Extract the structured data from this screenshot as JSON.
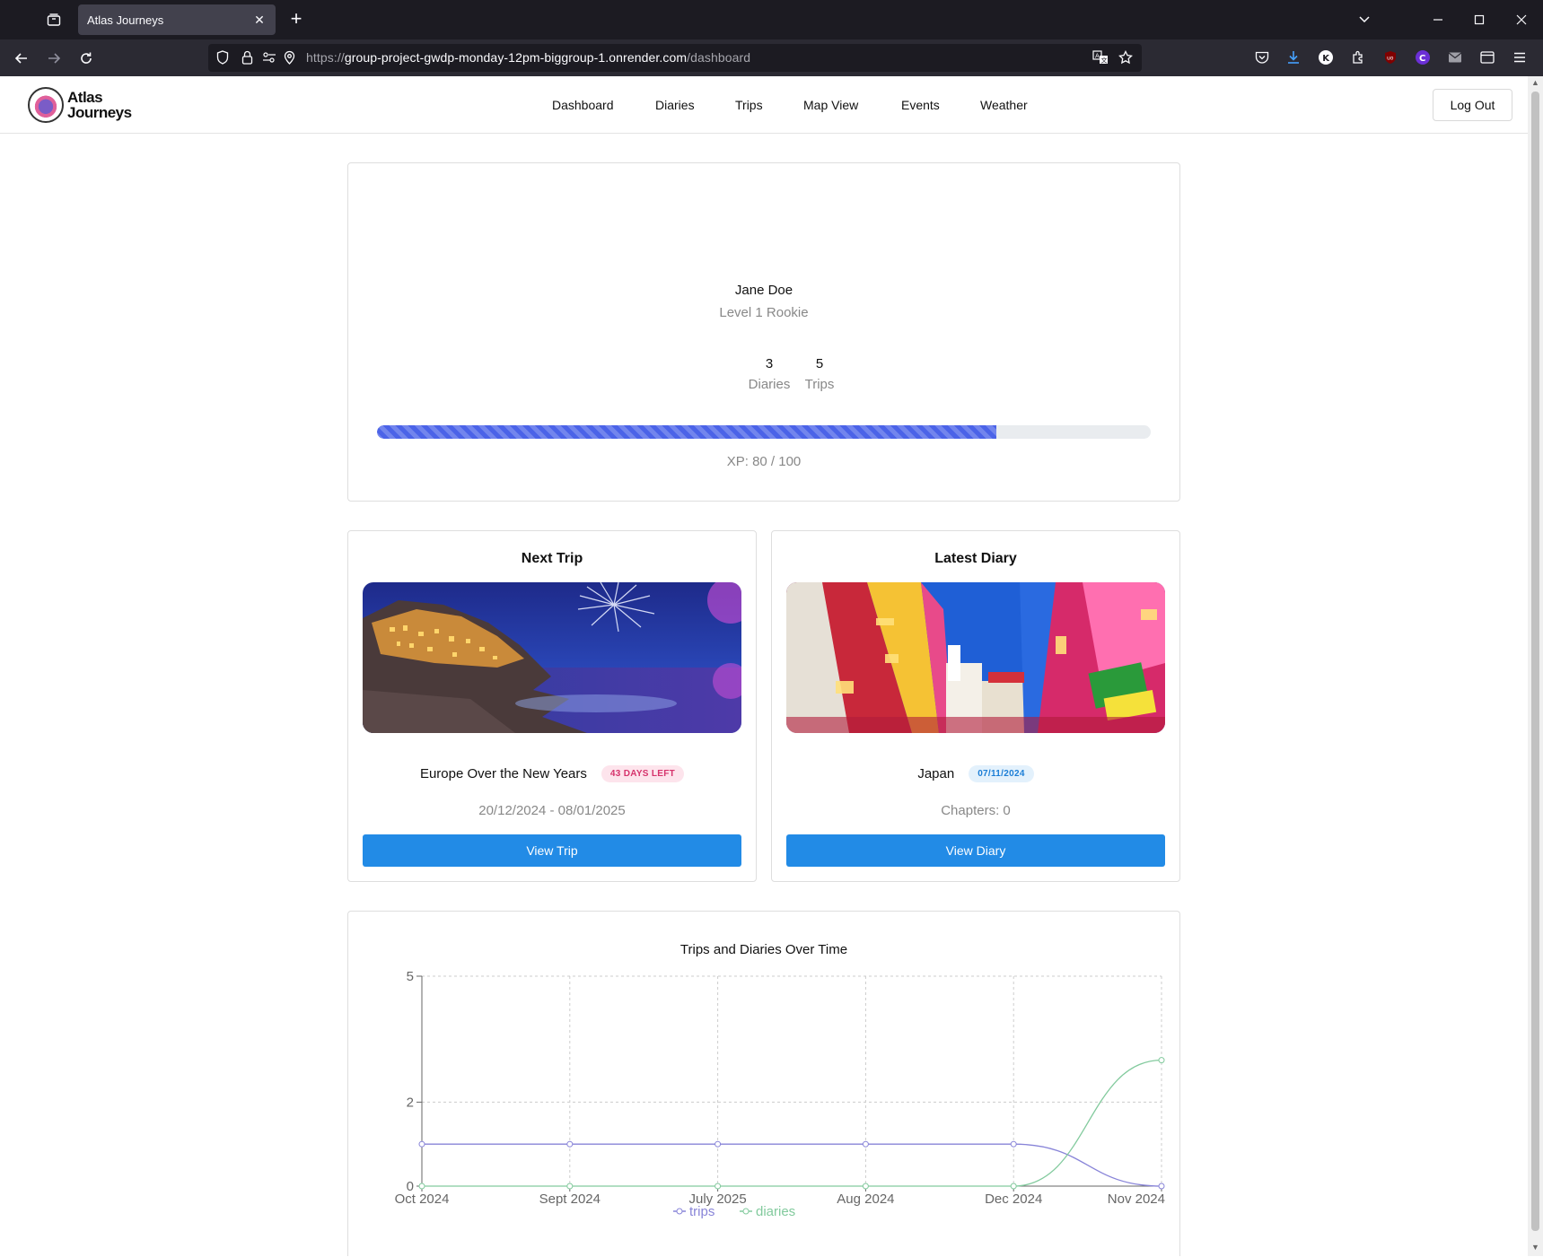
{
  "browser": {
    "tab_title": "Atlas Journeys",
    "url_secure_prefix": "https://",
    "url_host": "group-project-gwdp-monday-12pm-biggroup-1.onrender.com",
    "url_path": "/dashboard"
  },
  "site": {
    "logo_line1": "Atlas",
    "logo_line2": "Journeys",
    "nav": [
      "Dashboard",
      "Diaries",
      "Trips",
      "Map View",
      "Events",
      "Weather"
    ],
    "logout_label": "Log Out"
  },
  "profile": {
    "name": "Jane Doe",
    "level": "Level 1 Rookie",
    "diaries_count": "3",
    "diaries_label": "Diaries",
    "trips_count": "5",
    "trips_label": "Trips",
    "xp_current": 80,
    "xp_max": 100,
    "xp_text": "XP: 80 / 100",
    "progress_color": "#4b63e8"
  },
  "next_trip": {
    "title": "Next Trip",
    "name": "Europe Over the New Years",
    "badge": "43 DAYS LEFT",
    "dates": "20/12/2024 - 08/01/2025",
    "button": "View Trip",
    "image": "coastal-village-fireworks-night"
  },
  "latest_diary": {
    "title": "Latest Diary",
    "name": "Japan",
    "badge": "07/11/2024",
    "chapters": "Chapters: 0",
    "button": "View Diary",
    "image": "tokyo-neon-street"
  },
  "chart_data": {
    "type": "line",
    "title": "Trips and Diaries Over Time",
    "categories": [
      "Oct 2024",
      "Sept 2024",
      "July 2025",
      "Aug 2024",
      "Dec 2024",
      "Nov 2024"
    ],
    "series": [
      {
        "name": "trips",
        "values": [
          1,
          1,
          1,
          1,
          1,
          0
        ],
        "color": "#8884d8"
      },
      {
        "name": "diaries",
        "values": [
          0,
          0,
          0,
          0,
          0,
          3
        ],
        "color": "#82ca9d"
      }
    ],
    "ylim": [
      0,
      5
    ],
    "yticks": [
      "0",
      "2",
      "5"
    ],
    "grid": true,
    "legend": "bottom-center"
  }
}
